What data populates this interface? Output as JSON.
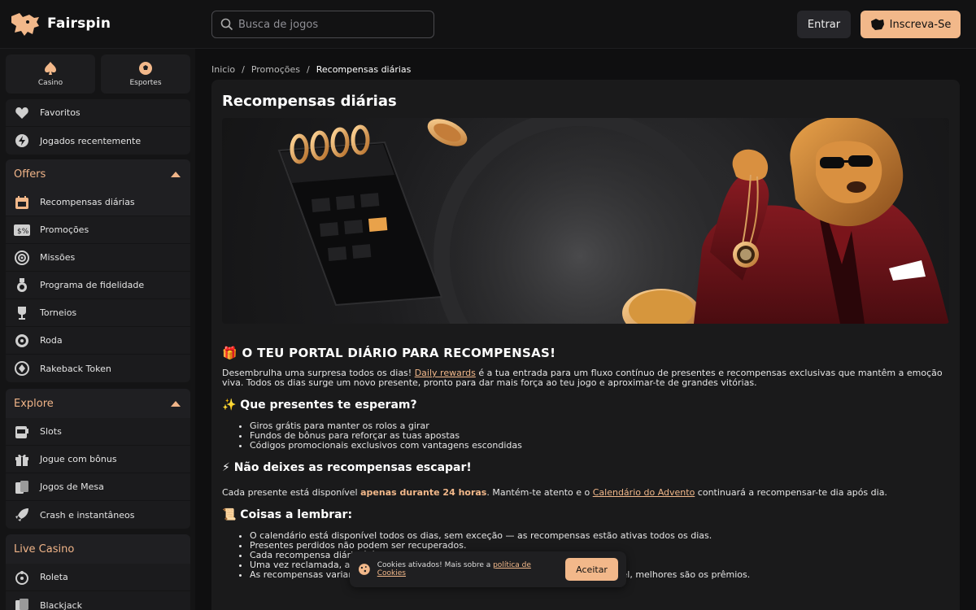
{
  "brand": {
    "name": "Fairspin"
  },
  "search": {
    "placeholder": "Busca de jogos"
  },
  "header": {
    "login_label": "Entrar",
    "signup_label": "Inscreva-Se"
  },
  "sidebar": {
    "tabs": [
      {
        "label": "Casino",
        "icon": "spade-icon"
      },
      {
        "label": "Esportes",
        "icon": "soccer-ball-icon"
      }
    ],
    "quick": [
      {
        "label": "Favoritos",
        "icon": "heart-icon"
      },
      {
        "label": "Jogados recentemente",
        "icon": "lightning-icon"
      }
    ],
    "offers": {
      "title": "Offers",
      "items": [
        {
          "label": "Recompensas diárias",
          "icon": "calendar-gift-icon"
        },
        {
          "label": "Promoções",
          "icon": "promo-ticket-icon"
        },
        {
          "label": "Missões",
          "icon": "target-icon"
        },
        {
          "label": "Programa de fidelidade",
          "icon": "medal-icon"
        },
        {
          "label": "Torneios",
          "icon": "trophy-icon"
        },
        {
          "label": "Roda",
          "icon": "wheel-icon"
        },
        {
          "label": "Rakeback Token",
          "icon": "token-icon"
        }
      ]
    },
    "explore": {
      "title": "Explore",
      "items": [
        {
          "label": "Slots",
          "icon": "slot-machine-icon"
        },
        {
          "label": "Jogue com bônus",
          "icon": "gift-icon"
        },
        {
          "label": "Jogos de Mesa",
          "icon": "cards-icon"
        },
        {
          "label": "Crash e instantâneos",
          "icon": "rocket-icon"
        }
      ]
    },
    "live": {
      "title": "Live Casino",
      "items": [
        {
          "label": "Roleta",
          "icon": "roulette-icon"
        },
        {
          "label": "Blackjack",
          "icon": "blackjack-icon"
        }
      ]
    }
  },
  "breadcrumb": {
    "home": "Inicio",
    "promos": "Promoções",
    "current": "Recompensas diárias",
    "sep": "/"
  },
  "main": {
    "title": "Recompensas diárias",
    "h_portal": "🎁 O TEU PORTAL DIÁRIO PARA RECOMPENSAS!",
    "p1_a": "Desembrulha uma surpresa todos os dias! ",
    "p1_link": "Daily rewards",
    "p1_b": " é a tua entrada para um fluxo contínuo de presentes e recompensas exclusivas que mantêm a emoção viva. Todos os dias surge um novo presente, pronto para dar mais força ao teu jogo e aproximar-te de grandes vitórias.",
    "h_gifts": "✨ Que presentes te esperam?",
    "gifts": [
      "Giros grátis para manter os rolos a girar",
      "Fundos de bônus para reforçar as tuas apostas",
      "Códigos promocionais exclusivos com vantagens escondidas"
    ],
    "h_dont": "⚡ Não deixes as recompensas escapar!",
    "p2_a": "Cada presente está disponível ",
    "p2_strong": "apenas durante 24 horas",
    "p2_b": ". Mantém-te atento e o ",
    "p2_link": "Calendário do Advento",
    "p2_c": " continuará a recompensar-te dia após dia.",
    "h_remember": "📜 Coisas a lembrar:",
    "remember": [
      "O calendário está disponível todos os dias, sem exceção — as recompensas estão ativas todos os dias.",
      "Presentes perdidos não podem ser recuperados.",
      "Cada recompensa diária é única.",
      "Uma vez reclamada, a mesma oferta não pode ser recebida novamente.",
      "As recompensas variam consoante o teu nível de lealdade – quanto mais alto o nível, melhores são os prêmios."
    ]
  },
  "cookie": {
    "text": "Cookies ativados! Mais sobre a ",
    "link": "política de Cookies",
    "accept": "Aceitar"
  },
  "colors": {
    "accent": "#f2b88a",
    "bg": "#0f0f10",
    "panel": "#1a1a1b"
  }
}
